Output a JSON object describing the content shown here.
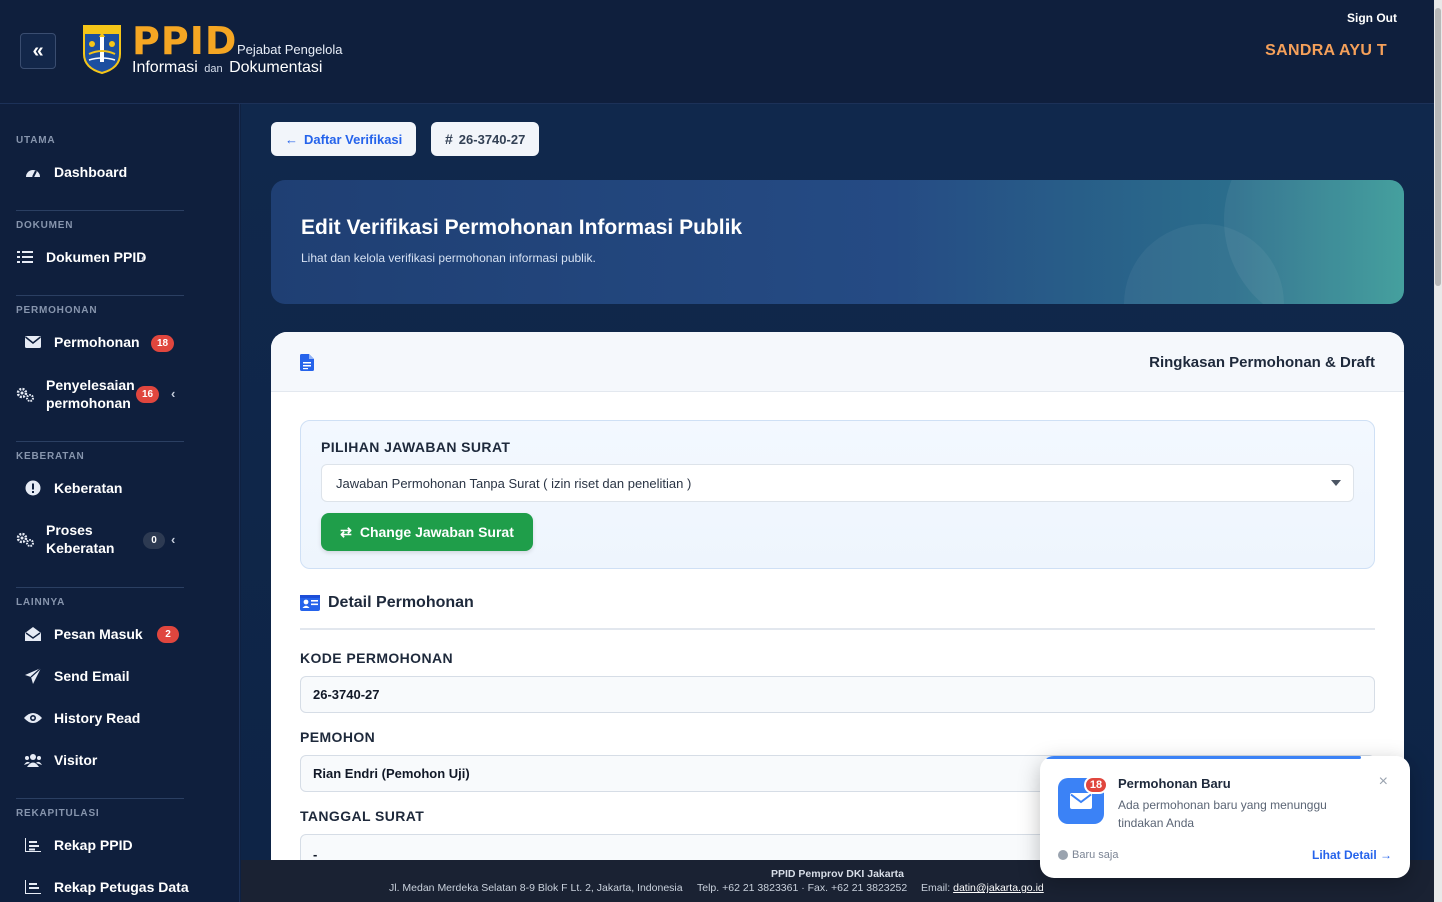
{
  "header": {
    "brand": "PPID",
    "brand_line1": "Pejabat Pengelola",
    "brand_line2a": "Informasi",
    "brand_line2b": "dan",
    "brand_line2c": "Dokumentasi",
    "sign_out": "Sign Out",
    "username": "SANDRA AYU T"
  },
  "sidebar": {
    "sections": {
      "utama": "UTAMA",
      "dokumen": "DOKUMEN",
      "permohonan": "PERMOHONAN",
      "keberatan": "KEBERATAN",
      "lainnya": "LAINNYA",
      "rekapitulasi": "REKAPITULASI"
    },
    "items": {
      "dashboard": "Dashboard",
      "dokumen_ppid": "Dokumen PPID",
      "permohonan": "Permohonan",
      "permohonan_badge": "18",
      "penyelesaian_1": "Penyelesaian",
      "penyelesaian_2": "permohonan",
      "penyelesaian_badge": "16",
      "keberatan": "Keberatan",
      "proses_1": "Proses",
      "proses_2": "Keberatan",
      "proses_badge": "0",
      "pesan_masuk": "Pesan Masuk",
      "pesan_badge": "2",
      "send_email": "Send Email",
      "history_read": "History Read",
      "visitor": "Visitor",
      "rekap_ppid": "Rekap PPID",
      "rekap_petugas": "Rekap Petugas Data"
    }
  },
  "main": {
    "back_label": "Daftar Verifikasi",
    "code_label": "26-3740-27",
    "hero_title": "Edit Verifikasi Permohonan Informasi Publik",
    "hero_subtitle": "Lihat dan kelola verifikasi permohonan informasi publik.",
    "card_title": "Ringkasan Permohonan & Draft",
    "choice_label": "PILIHAN JAWABAN SURAT",
    "choice_value": "Jawaban Permohonan Tanpa Surat ( izin riset dan penelitian )",
    "change_button": "Change Jawaban Surat",
    "detail_title": "Detail Permohonan",
    "fields": {
      "kode_label": "KODE PERMOHONAN",
      "kode_value": "26-3740-27",
      "pemohon_label": "PEMOHON",
      "pemohon_value": "Rian Endri (Pemohon Uji)",
      "tanggal_label": "TANGGAL SURAT",
      "tanggal_value": "-"
    }
  },
  "footer": {
    "org": "PPID Pemprov DKI Jakarta",
    "address": "Jl. Medan Merdeka Selatan 8-9 Blok F Lt. 2, Jakarta, Indonesia",
    "phone": "Telp. +62 21 3823361 · Fax. +62 21 3823252",
    "email_label": "Email:",
    "email": "datin@jakarta.go.id"
  },
  "toast": {
    "badge": "18",
    "title": "Permohonan Baru",
    "message": "Ada permohonan baru yang menunggu tindakan Anda",
    "time": "Baru saja",
    "link": "Lihat Detail →",
    "close": "×"
  },
  "colors": {
    "navy": "#0f1f3d",
    "accent_orange": "#f5a623",
    "username": "#f5a05a",
    "primary_blue": "#2563eb",
    "green": "#1f9e4a",
    "badge_red": "#e0463e"
  }
}
